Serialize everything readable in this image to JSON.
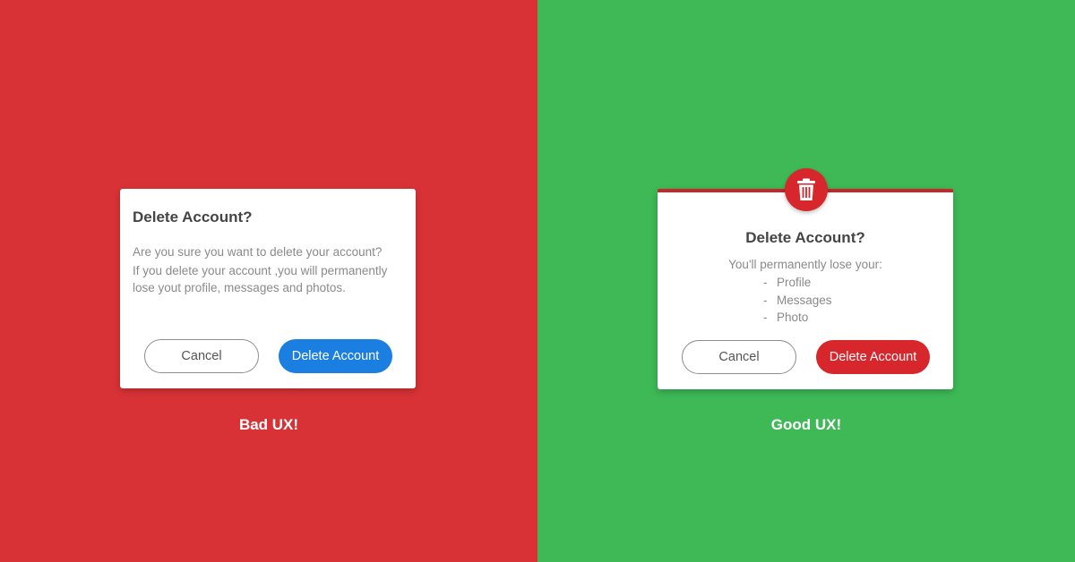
{
  "colors": {
    "bad_background": "#d83236",
    "good_background": "#3eb956",
    "primary_blue": "#1a7fe0",
    "danger_red": "#d7262c"
  },
  "bad": {
    "dialog": {
      "title": "Delete Account?",
      "message_line1": "Are you sure you want to delete your account?",
      "message_line2": "If you delete your account ,you will permanently",
      "message_line3": "lose yout profile, messages and photos.",
      "cancel_label": "Cancel",
      "delete_label": "Delete Account"
    },
    "caption": "Bad UX!"
  },
  "good": {
    "dialog": {
      "icon": "trash-icon",
      "title": "Delete Account?",
      "intro": "You'll permanently lose your:",
      "items": [
        {
          "dash": "-",
          "label": "Profile"
        },
        {
          "dash": "-",
          "label": "Messages"
        },
        {
          "dash": "-",
          "label": "Photo"
        }
      ],
      "cancel_label": "Cancel",
      "delete_label": "Delete Account"
    },
    "caption": "Good UX!"
  }
}
